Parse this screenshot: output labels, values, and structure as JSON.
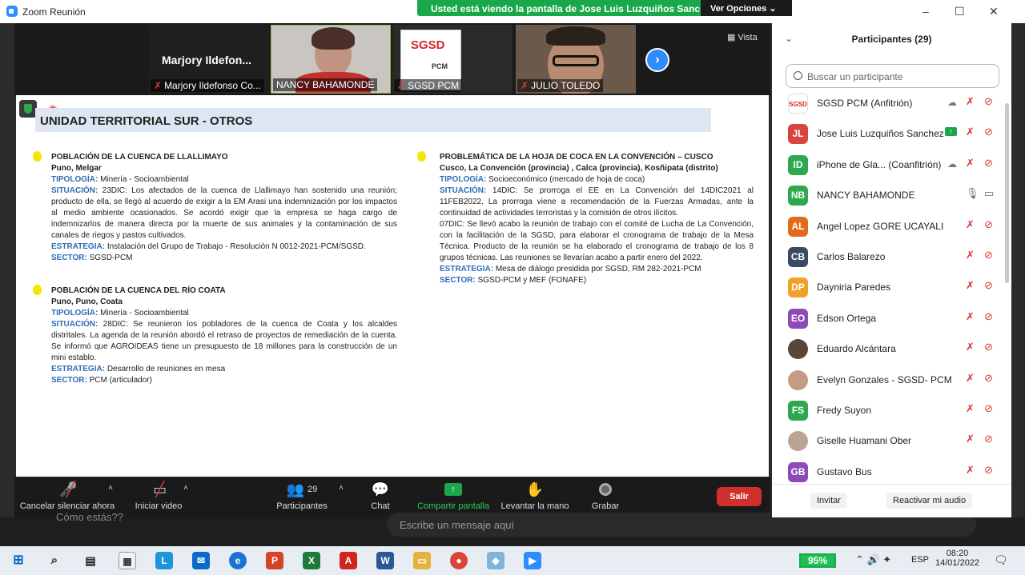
{
  "window": {
    "title": "Zoom Reunión",
    "minimize": "–",
    "maximize": "☐",
    "close": "✕"
  },
  "share_banner": {
    "text": "Usted está viendo la pantalla de Jose Luis Luzquiños Sanchez",
    "options": "Ver Opciones ⌄"
  },
  "video_strip": {
    "view_label": "Vista",
    "tiles": [
      {
        "big_name": "Marjory  Ildefon...",
        "label": "Marjory Ildefonso Co..."
      },
      {
        "label": "NANCY BAHAMONDE"
      },
      {
        "label": "SGSD PCM",
        "logo_text": "SGSD",
        "logo_sub": "PCM"
      },
      {
        "label": "JULIO TOLEDO"
      }
    ]
  },
  "slide": {
    "title": "UNIDAD TERRITORIAL SUR - OTROS",
    "items": [
      {
        "heading": "POBLACIÓN DE LA CUENCA DE LLALLIMAYO",
        "location": "Puno, Melgar",
        "tipologia_k": "TIPOLOGÍA:",
        "tipologia": " Minería  - Socioambiental",
        "situacion_k": "SITUACIÓN:",
        "situacion": " 23DIC: Los afectados de la cuenca de Llallimayo han sostenido una reunión; producto de ella, se llegó al acuerdo de exigir a la EM Arasi una indemnización por los impactos al medio ambiente ocasionados. Se acordó exigir que la empresa se haga cargo de indemnizarlos de manera directa por la muerte de sus animales y la contaminación de sus canales de riegos y pastos cultivados.",
        "estrategia_k": "ESTRATEGIA:",
        "estrategia": " Instalación del Grupo de Trabajo - Resolución N 0012-2021-PCM/SGSD.",
        "sector_k": "SECTOR:",
        "sector": " SGSD-PCM"
      },
      {
        "heading": "POBLACIÓN DE LA CUENCA DEL RÍO COATA",
        "location": "Puno, Puno, Coata",
        "tipologia_k": "TIPOLOGÍA:",
        "tipologia": " Minería  - Socioambiental",
        "situacion_k": "SITUACIÓN:",
        "situacion": " 28DIC: Se reunieron los pobladores de la cuenca de Coata y los alcaldes distritales. La agenda de la reunión abordó el retraso de proyectos de remediación de la cuenta. Se informó que AGROIDEAS tiene un presupuesto de 18 millones para la construcción de un mini establo.",
        "estrategia_k": "ESTRATEGIA:",
        "estrategia": " Desarrollo de reuniones en mesa",
        "sector_k": "SECTOR:",
        "sector": " PCM (articulador)"
      },
      {
        "heading": "PROBLEMÁTICA DE LA HOJA DE COCA EN LA CONVENCIÓN – CUSCO",
        "location": "Cusco, La Convención (provincia) , Calca (provincia), Kosñipata (distrito)",
        "tipologia_k": "TIPOLOGÍA:",
        "tipologia": " Socioeconómico (mercado de hoja de coca)",
        "situacion_k": "SITUACIÓN:",
        "situacion": " 14DIC: Se prorroga el EE en La Convención del 14DIC2021 al 11FEB2022. La prorroga viene a recomendación de la Fuerzas Armadas, ante la continuidad de actividades terroristas y la comisión de otros ilícitos.",
        "situacion2": "07DIC: Se llevó acabo la reunión de trabajo con el comité de Lucha de La Convención, con la facilitación de la SGSD, para elaborar el cronograma de trabajo de la Mesa Técnica. Producto de la reunión se ha elaborado el cronograma de trabajo de los 8 grupos técnicas. Las reuniones se llevarían acabo a partir enero del 2022.",
        "estrategia_k": "ESTRATEGIA:",
        "estrategia": " Mesa de diálogo presidida por SGSD, RM 282-2021-PCM",
        "sector_k": "SECTOR:",
        "sector": " SGSD-PCM y MEF (FONAFE)"
      }
    ]
  },
  "toolbar": {
    "mute": "Cancelar silenciar ahora",
    "video": "Iniciar video",
    "participants": "Participantes",
    "participants_count": "29",
    "chat": "Chat",
    "share": "Compartir pantalla",
    "raise": "Levantar la mano",
    "record": "Grabar",
    "leave": "Salir"
  },
  "chat_bg": {
    "last_msg": "Cómo estás??",
    "placeholder": "Escribe un mensaje aquí"
  },
  "panel": {
    "title": "Participantes (29)",
    "search_placeholder": "Buscar un participante",
    "participants": [
      {
        "initials": "SGSD",
        "name": "SGSD PCM (Anfitrión)",
        "color": "#ffffff",
        "mic": "muted",
        "cam": "off",
        "extra": "cloud"
      },
      {
        "initials": "JL",
        "name": "Jose Luis Luzquiños Sanchez",
        "color": "#d9453d",
        "mic": "muted",
        "cam": "off",
        "extra": "share"
      },
      {
        "initials": "ID",
        "name": "iPhone de Gla... (Coanfitrión)",
        "color": "#2ea84f",
        "mic": "muted",
        "cam": "off",
        "extra": "cloud"
      },
      {
        "initials": "NB",
        "name": "NANCY BAHAMONDE",
        "color": "#2ea84f",
        "mic": "on",
        "cam": "on",
        "extra": ""
      },
      {
        "initials": "AL",
        "name": "Angel Lopez GORE UCAYALI",
        "color": "#e46a1b",
        "mic": "muted",
        "cam": "off",
        "extra": ""
      },
      {
        "initials": "CB",
        "name": "Carlos Balarezo",
        "color": "#3a4a63",
        "mic": "muted",
        "cam": "off",
        "extra": ""
      },
      {
        "initials": "DP",
        "name": "Dayniria Paredes",
        "color": "#f0a12a",
        "mic": "muted",
        "cam": "off",
        "extra": ""
      },
      {
        "initials": "EO",
        "name": "Edson Ortega",
        "color": "#8e4ab8",
        "mic": "muted",
        "cam": "off",
        "extra": ""
      },
      {
        "initials": "",
        "name": "Eduardo Alcántara",
        "color": "#5a4537",
        "mic": "muted",
        "cam": "off",
        "extra": ""
      },
      {
        "initials": "",
        "name": "Evelyn Gonzales - SGSD- PCM",
        "color": "#c79a84",
        "mic": "muted",
        "cam": "off",
        "extra": ""
      },
      {
        "initials": "FS",
        "name": "Fredy Suyon",
        "color": "#2ea84f",
        "mic": "muted",
        "cam": "off",
        "extra": ""
      },
      {
        "initials": "",
        "name": "Giselle Huamani Ober",
        "color": "#b8a596",
        "mic": "muted",
        "cam": "off",
        "extra": ""
      },
      {
        "initials": "GB",
        "name": "Gustavo Bus",
        "color": "#8e4ab8",
        "mic": "muted",
        "cam": "off",
        "extra": ""
      }
    ],
    "invite": "Invitar",
    "unmute_me": "Reactivar mi audio"
  },
  "taskbar": {
    "battery": "95%",
    "lang": "ESP",
    "time": "08:20",
    "date": "14/01/2022"
  },
  "colors": {
    "zoom_blue": "#2d8cff",
    "share_green": "#18a84a",
    "leave_red": "#d0302b",
    "slide_key_blue": "#2d6db5"
  }
}
